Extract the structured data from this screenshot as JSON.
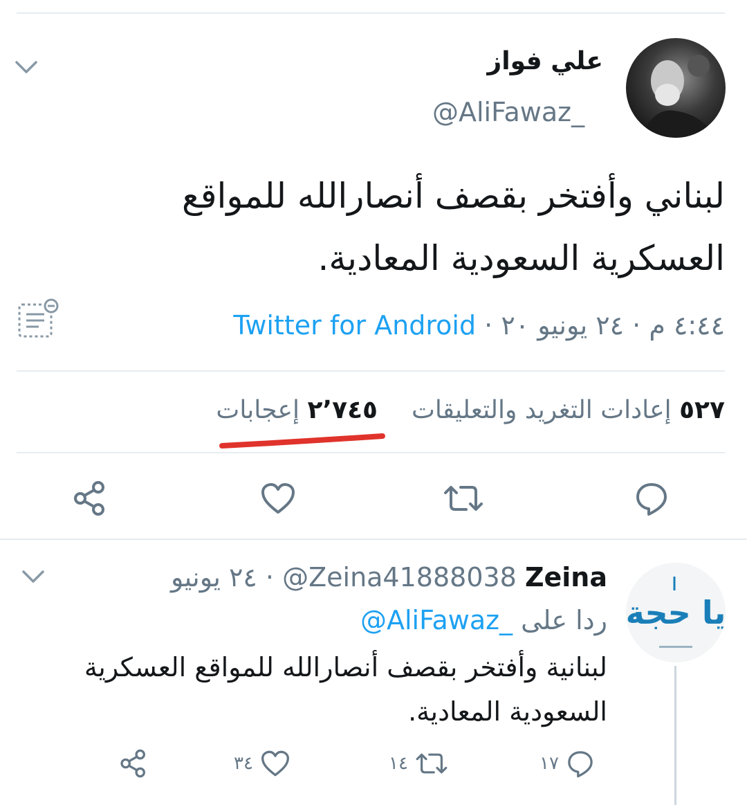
{
  "tweet": {
    "name": "علي فواز",
    "handle": "@AliFawaz_",
    "text_line1": "لبناني وأفتخر بقصف أنصارالله للمواقع",
    "text_line2": "العسكرية السعودية المعادية.",
    "time": "٤:٤٤ م",
    "date": "٢٤ يونيو ٢٠",
    "separator": "·",
    "source": "Twitter for Android",
    "retweets_count": "٥٢٧",
    "retweets_label": "إعادات التغريد والتعليقات",
    "likes_count": "٢٬٧٤٥",
    "likes_label": "إعجابات",
    "highlight_color": "#e0332b"
  },
  "reply": {
    "name": "Zeina",
    "handle": "@Zeina41888038",
    "separator": "·",
    "date": "٢٤ يونيو",
    "replying_to_label": "ردا على",
    "replying_to_handle": "@AliFawaz_",
    "text_line1": "لبنانية وأفتخر بقصف أنصارالله للمواقع العسكرية",
    "text_line2": "السعودية المعادية.",
    "replies_count": "١٧",
    "retweets_count": "١٤",
    "likes_count": "٣٤"
  },
  "colors": {
    "accent": "#1da1f2",
    "secondary_text": "#657786",
    "divider": "#e6ecf0"
  }
}
